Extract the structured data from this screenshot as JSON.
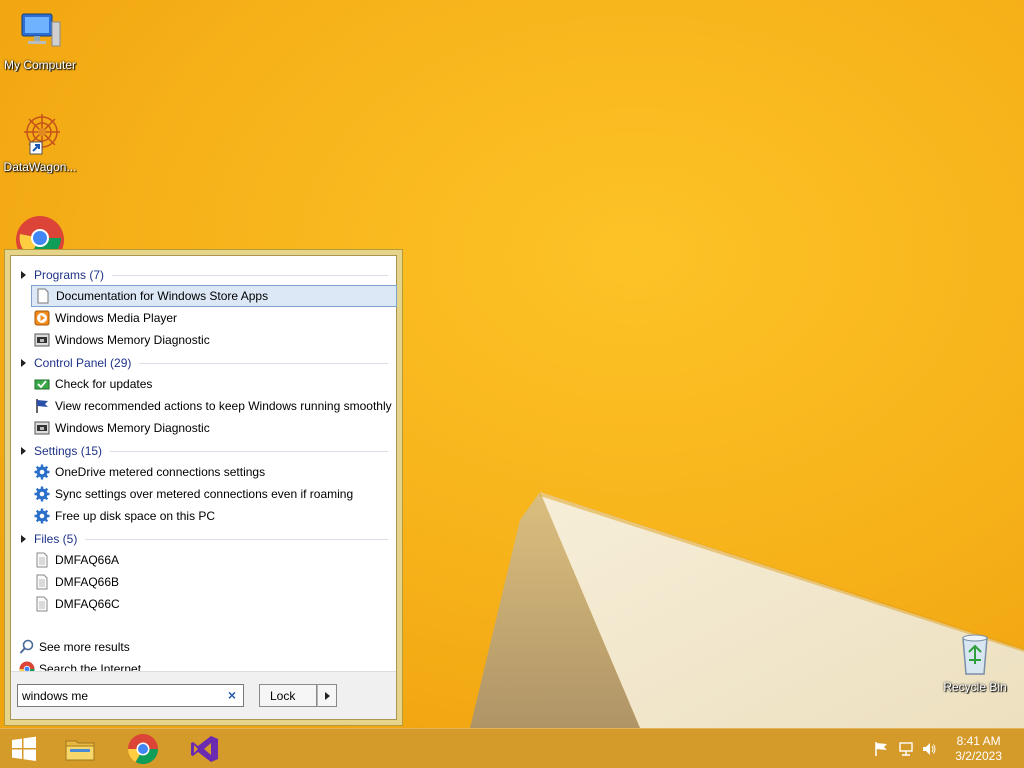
{
  "desktop": {
    "icons": [
      {
        "label": "My Computer"
      },
      {
        "label": "DataWagon..."
      },
      {
        "label": "Recycle Bin"
      }
    ]
  },
  "start_menu": {
    "groups": [
      {
        "header": "Programs (7)",
        "items": [
          {
            "label": "Documentation for Windows Store Apps",
            "icon": "document-icon",
            "selected": true
          },
          {
            "label": "Windows Media Player",
            "icon": "media-player-icon"
          },
          {
            "label": "Windows Memory Diagnostic",
            "icon": "memory-diagnostic-icon"
          }
        ]
      },
      {
        "header": "Control Panel (29)",
        "items": [
          {
            "label": "Check for updates",
            "icon": "windows-update-icon"
          },
          {
            "label": "View recommended actions to keep Windows running smoothly",
            "icon": "action-center-flag-icon"
          },
          {
            "label": "Windows Memory Diagnostic",
            "icon": "memory-diagnostic-icon"
          }
        ]
      },
      {
        "header": "Settings (15)",
        "items": [
          {
            "label": "OneDrive metered connections settings",
            "icon": "gear-icon"
          },
          {
            "label": "Sync settings over metered connections even if roaming",
            "icon": "gear-icon"
          },
          {
            "label": "Free up disk space on this PC",
            "icon": "gear-icon"
          }
        ]
      },
      {
        "header": "Files (5)",
        "items": [
          {
            "label": "DMFAQ66A",
            "icon": "file-icon"
          },
          {
            "label": "DMFAQ66B",
            "icon": "file-icon"
          },
          {
            "label": "DMFAQ66C",
            "icon": "file-icon"
          }
        ]
      }
    ],
    "see_more": "See more results",
    "search_internet": "Search the Internet",
    "search": {
      "value": "windows me"
    },
    "lock_label": "Lock"
  },
  "taskbar": {
    "clock_time": "8:41 AM",
    "clock_date": "3/2/2023"
  },
  "colors": {
    "wallpaper": "#f6b21a",
    "group_header_text": "#1e3287",
    "selection_bg": "#dde8f6"
  }
}
